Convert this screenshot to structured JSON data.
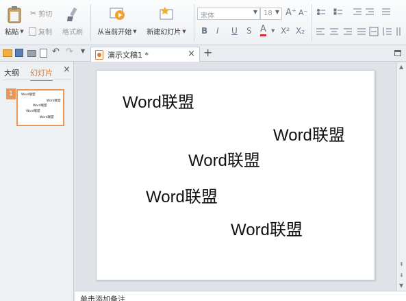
{
  "ribbon": {
    "paste_label": "粘贴",
    "cut_label": "剪切",
    "copy_label": "复制",
    "format_painter_label": "格式刷",
    "from_current_label": "从当前开始",
    "new_slide_label": "新建幻灯片",
    "font_name": "宋体",
    "font_size": "18",
    "bold": "B",
    "italic": "I",
    "underline": "U",
    "strikethrough": "S",
    "font_color": "A",
    "superscript": "X²",
    "subscript": "X₂",
    "grow_font": "A⁺",
    "shrink_font": "A⁻"
  },
  "tabbar": {
    "document_tab": "演示文稿1 *",
    "new_tab": "+"
  },
  "left_panel": {
    "tab_outline": "大纲",
    "tab_slides": "幻灯片",
    "close": "×",
    "thumbnail_number": "1",
    "thumbnail_texts": [
      "Word联盟",
      "Word联盟",
      "Word联盟",
      "Word联盟",
      "Word联盟"
    ]
  },
  "slide": {
    "texts": [
      "Word联盟",
      "Word联盟",
      "Word联盟",
      "Word联盟",
      "Word联盟"
    ]
  },
  "notes": {
    "placeholder": "单击添加备注"
  },
  "colors": {
    "accent": "#e8975a",
    "active_tab_text": "#d9782d"
  }
}
